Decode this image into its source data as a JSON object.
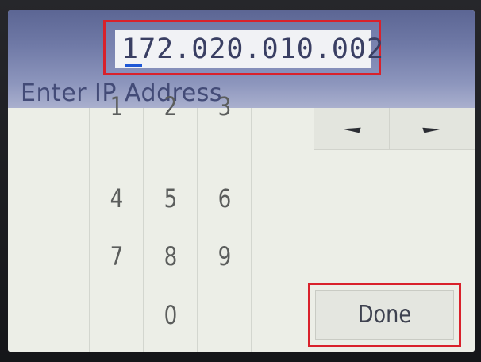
{
  "ip_entry": {
    "value": "172.020.010.002"
  },
  "prompt": "Enter IP Address",
  "keypad": {
    "row1": [
      "1",
      "2",
      "3"
    ],
    "row2": [
      "4",
      "5",
      "6"
    ],
    "row3": [
      "7",
      "8",
      "9"
    ],
    "zero": "0"
  },
  "arrows": {
    "left": "◄",
    "right": "►"
  },
  "done_label": "Done",
  "colors": {
    "highlight": "#d9212b",
    "header": "#6f79a6",
    "caret": "#1e57d6"
  }
}
